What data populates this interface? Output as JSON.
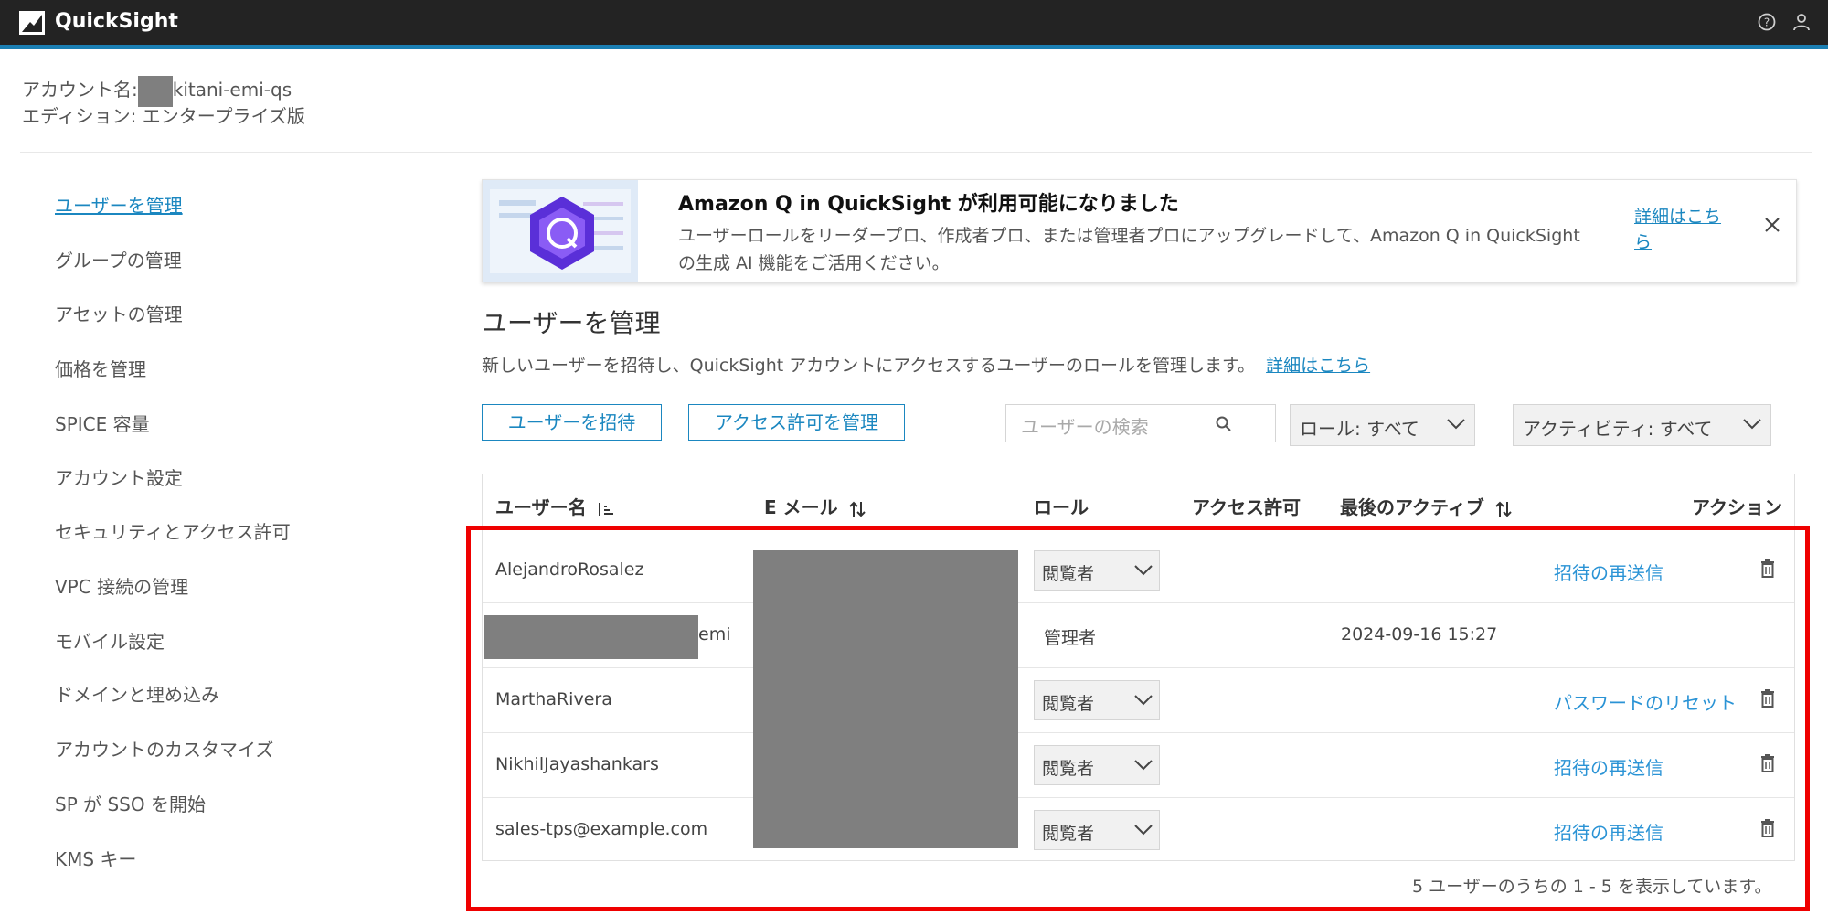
{
  "app": {
    "title": "QuickSight",
    "colors": {
      "topbar": "#232323",
      "accent": "#1b7fb3",
      "link": "#1b87c0",
      "highlight": "#ef0000"
    },
    "icons": {
      "help": "help-circle-icon",
      "user": "user-icon",
      "logo": "quicksight-logo-icon"
    }
  },
  "account": {
    "name_label": "アカウント名:",
    "name_value": "kitani-emi-qs",
    "edition": "エディション: エンタープライズ版"
  },
  "sidebar": {
    "items": [
      {
        "label": "ユーザーを管理",
        "active": true
      },
      {
        "label": "グループの管理"
      },
      {
        "label": "アセットの管理"
      },
      {
        "label": "価格を管理"
      },
      {
        "label": "SPICE 容量"
      },
      {
        "label": "アカウント設定"
      },
      {
        "label": "セキュリティとアクセス許可"
      },
      {
        "label": "VPC 接続の管理"
      },
      {
        "label": "モバイル設定"
      },
      {
        "label": "ドメインと埋め込み"
      },
      {
        "label": "アカウントのカスタマイズ"
      },
      {
        "label": "SP が SSO を開始"
      },
      {
        "label": "KMS キー"
      }
    ]
  },
  "banner": {
    "title": "Amazon Q in QuickSight が利用可能になりました",
    "body": "ユーザーロールをリーダープロ、作成者プロ、または管理者プロにアップグレードして、Amazon Q in QuickSight の生成 AI 機能をご活用ください。",
    "link": "詳細はこちら",
    "icon": "amazon-q-icon"
  },
  "main": {
    "title": "ユーザーを管理",
    "description": "新しいユーザーを招待し、QuickSight アカウントにアクセスするユーザーのロールを管理します。",
    "description_link": "詳細はこちら",
    "invite_button": "ユーザーを招待",
    "permissions_button": "アクセス許可を管理",
    "search_placeholder": "ユーザーの検索",
    "role_filter": "ロール: すべて",
    "activity_filter": "アクティビティ: すべて"
  },
  "table": {
    "headers": {
      "username": "ユーザー名",
      "email": "E メール",
      "role": "ロール",
      "access": "アクセス許可",
      "last_active": "最後のアクティブ",
      "actions": "アクション"
    },
    "rows": [
      {
        "username": "AlejandroRosalez",
        "role": "閲覧者",
        "role_editable": true,
        "last_active": "",
        "action": "招待の再送信",
        "deletable": true
      },
      {
        "username": "emi",
        "username_redacted": true,
        "role": "管理者",
        "role_editable": false,
        "last_active": "2024-09-16 15:27",
        "action": "",
        "deletable": false
      },
      {
        "username": "MarthaRivera",
        "role": "閲覧者",
        "role_editable": true,
        "last_active": "",
        "action": "パスワードのリセット",
        "deletable": true
      },
      {
        "username": "NikhilJayashankars",
        "role": "閲覧者",
        "role_editable": true,
        "last_active": "",
        "action": "招待の再送信",
        "deletable": true
      },
      {
        "username": "sales-tps@example.com",
        "role": "閲覧者",
        "role_editable": true,
        "last_active": "",
        "action": "招待の再送信",
        "deletable": true
      }
    ],
    "footer": "5 ユーザーのうちの 1 - 5 を表示しています。"
  }
}
